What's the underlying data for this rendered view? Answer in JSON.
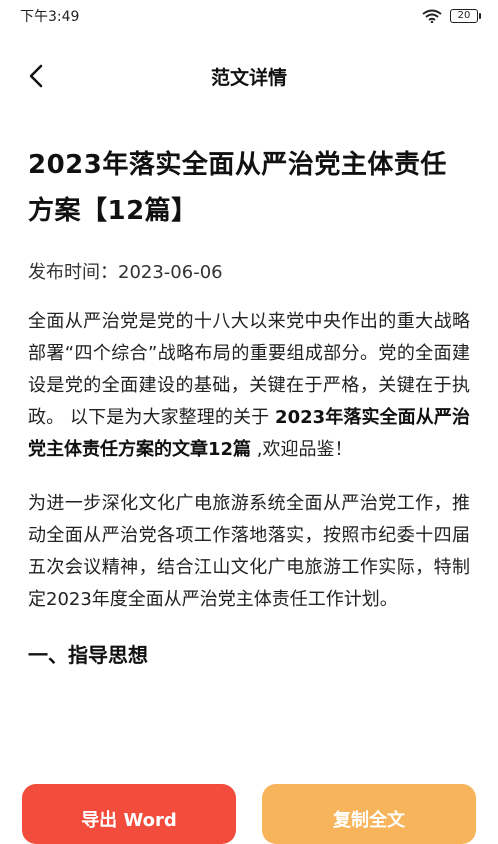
{
  "status": {
    "time": "下午3:49",
    "battery": "20"
  },
  "nav": {
    "title": "范文详情"
  },
  "article": {
    "title": "2023年落实全面从严治党主体责任方案【12篇】",
    "publish_label": "发布时间：",
    "publish_date": "2023-06-06",
    "intro_before": "全面从严治党是党的十八大以来党中央作出的重大战略部署“四个综合”战略布局的重要组成部分。党的全面建设是党的全面建设的基础，关键在于严格，关键在于执政。 以下是为大家整理的关于 ",
    "intro_bold": "2023年落实全面从严治党主体责任方案的文章12篇",
    "intro_after": " ,欢迎品鉴！",
    "paragraph2": "为进一步深化文化广电旅游系统全面从严治党工作，推动全面从严治党各项工作落地落实，按照市纪委十四届五次会议精神，结合江山文化广电旅游工作实际，特制定2023年度全面从严治党主体责任工作计划。",
    "section1": "一、指导思想"
  },
  "actions": {
    "export_label": "导出 Word",
    "copy_label": "复制全文"
  }
}
